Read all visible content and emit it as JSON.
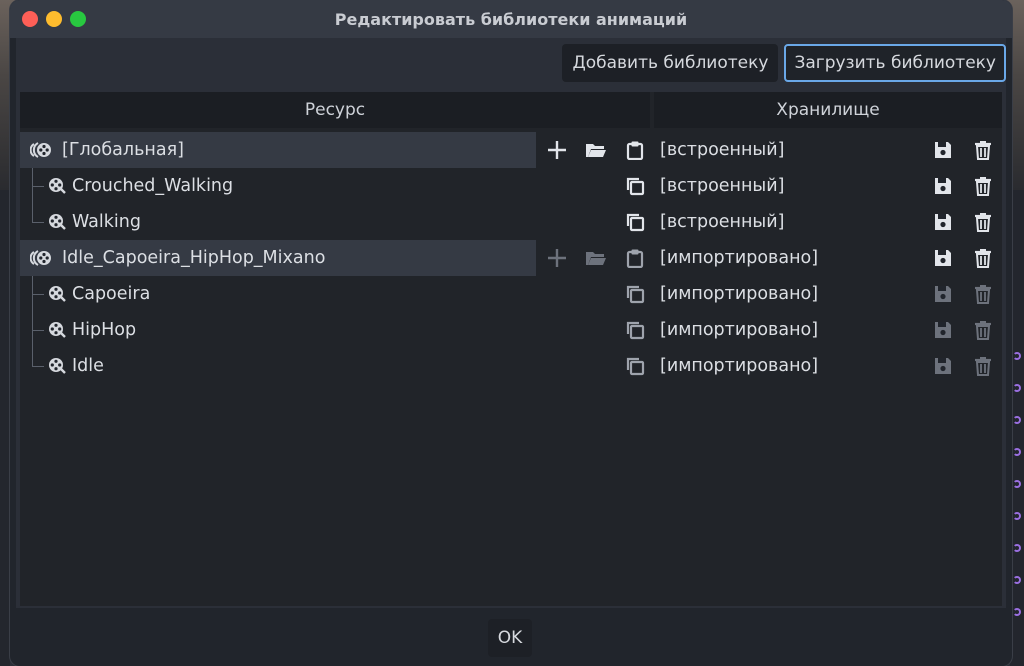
{
  "window": {
    "title": "Редактировать библиотеки анимаций"
  },
  "toolbar": {
    "add_library_label": "Добавить библиотеку",
    "load_library_label": "Загрузить библиотеку"
  },
  "table": {
    "columns": [
      "Ресурс",
      "Хранилище"
    ],
    "rows": [
      {
        "kind": "library",
        "name": "[Глобальная]",
        "storage": "[встроенный]",
        "enabled": true
      },
      {
        "kind": "animation",
        "name": "Crouched_Walking",
        "storage": "[встроенный]",
        "enabled": true
      },
      {
        "kind": "animation",
        "name": "Walking",
        "storage": "[встроенный]",
        "enabled": true
      },
      {
        "kind": "library",
        "name": "Idle_Capoeira_HipHop_Mixano",
        "storage": "[импортировано]",
        "enabled": true
      },
      {
        "kind": "animation",
        "name": "Capoeira",
        "storage": "[импортировано]",
        "enabled": false
      },
      {
        "kind": "animation",
        "name": "HipHop",
        "storage": "[импортировано]",
        "enabled": false
      },
      {
        "kind": "animation",
        "name": "Idle",
        "storage": "[импортировано]",
        "enabled": false
      }
    ]
  },
  "footer": {
    "ok_label": "OK"
  },
  "icons": {
    "library": "animation-library-icon",
    "animation": "animation-icon",
    "add": "plus-icon",
    "load": "folder-open-icon",
    "paste": "clipboard-paste-icon",
    "copy": "copy-icon",
    "save": "save-icon",
    "remove": "trash-icon"
  },
  "colors": {
    "accent": "#6aa8e8",
    "window_bg": "#21252c",
    "row_highlight": "#353a44"
  }
}
